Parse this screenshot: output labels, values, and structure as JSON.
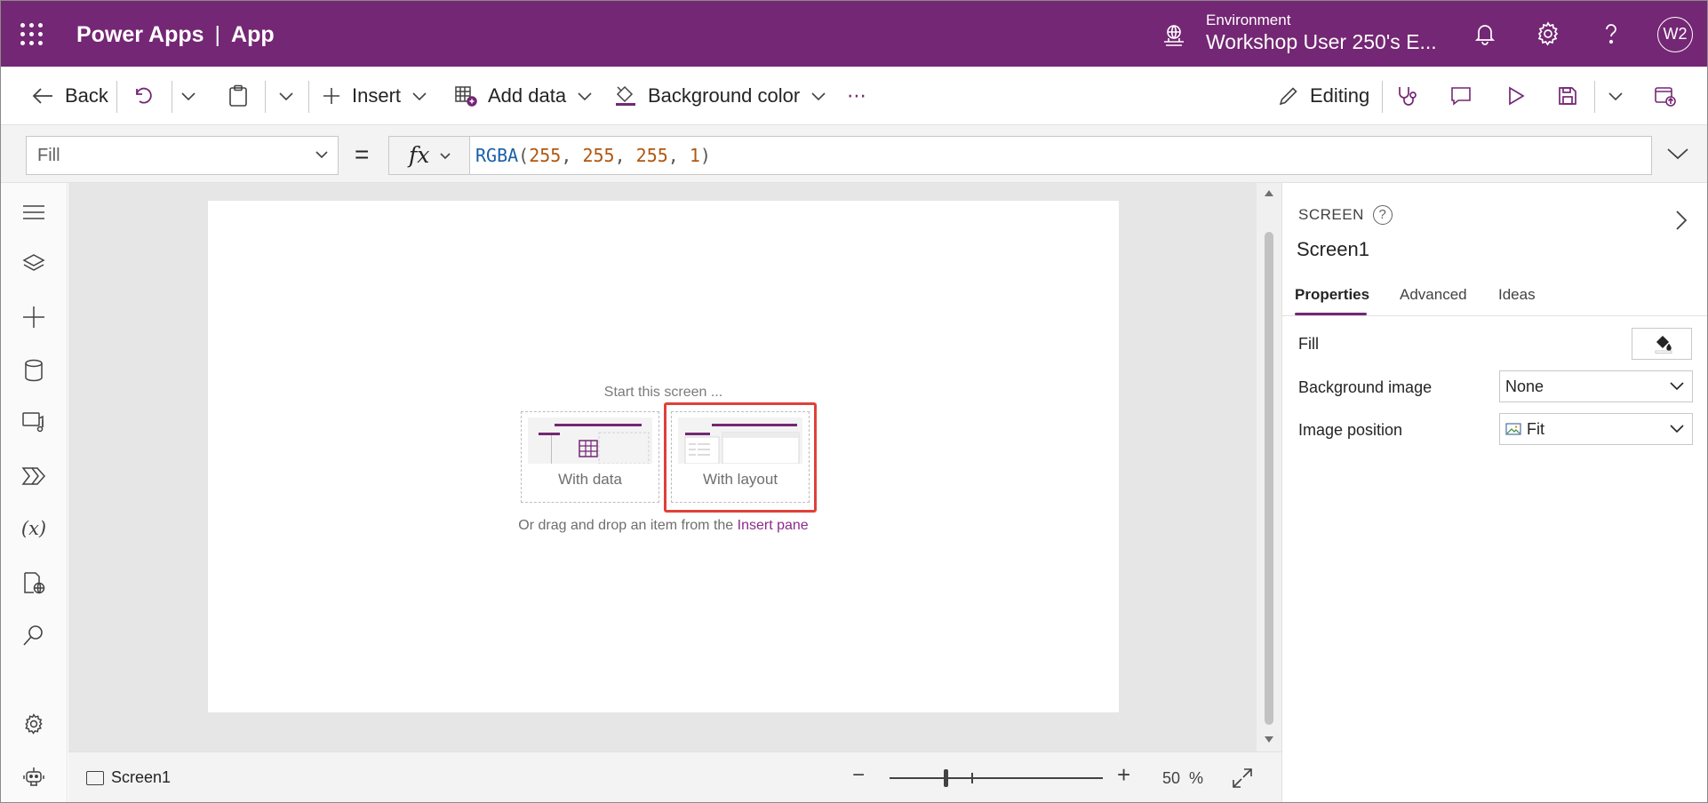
{
  "header": {
    "app_name": "Power Apps",
    "separator": "|",
    "app_label": "App",
    "environment_label": "Environment",
    "environment_name": "Workshop User 250's E...",
    "avatar_initials": "W2",
    "brand_color": "#742774"
  },
  "commandbar": {
    "back_label": "Back",
    "insert_label": "Insert",
    "add_data_label": "Add data",
    "background_color_label": "Background color",
    "more_label": "⋯",
    "editing_label": "Editing"
  },
  "formula_bar": {
    "property": "Fill",
    "equals": "=",
    "fx_label": "fx",
    "formula_fn": "RGBA",
    "formula_open": "(",
    "formula_r": "255",
    "formula_comma1": ", ",
    "formula_g": "255",
    "formula_comma2": ", ",
    "formula_b": "255",
    "formula_comma3": ", ",
    "formula_a": "1",
    "formula_close": ")"
  },
  "canvas": {
    "start_title": "Start this screen ...",
    "tile_with_data": "With data",
    "tile_with_layout": "With layout",
    "drag_hint_prefix": "Or drag and drop an item from the ",
    "drag_hint_link": "Insert pane",
    "highlight_color": "#e0403a"
  },
  "status_bar": {
    "screen_name": "Screen1",
    "zoom_minus": "−",
    "zoom_plus": "+",
    "zoom_value": "50",
    "zoom_unit": "%"
  },
  "panel": {
    "kind": "SCREEN",
    "help": "?",
    "name": "Screen1",
    "tabs": [
      "Properties",
      "Advanced",
      "Ideas"
    ],
    "active_tab": "Properties",
    "fill_label": "Fill",
    "background_image_label": "Background image",
    "background_image_value": "None",
    "image_position_label": "Image position",
    "image_position_value": "Fit"
  },
  "rail": {
    "variables_icon_text": "(x)"
  }
}
